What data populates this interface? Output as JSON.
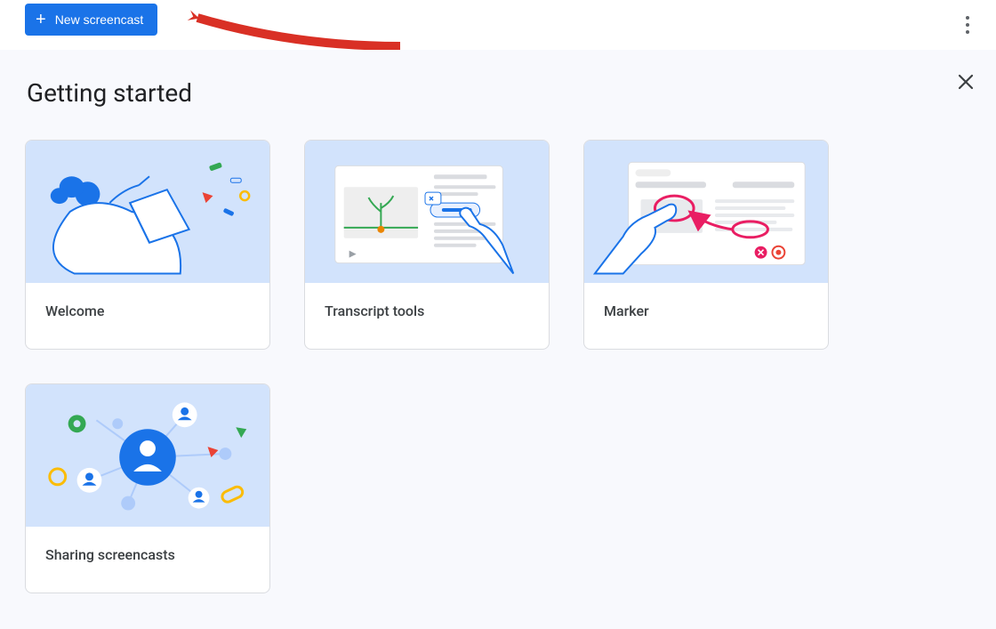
{
  "toolbar": {
    "new_button_label": "New screencast"
  },
  "panel": {
    "title": "Getting started"
  },
  "cards": [
    {
      "id": "welcome",
      "title": "Welcome"
    },
    {
      "id": "transcript",
      "title": "Transcript tools"
    },
    {
      "id": "marker",
      "title": "Marker"
    },
    {
      "id": "sharing",
      "title": "Sharing screencasts"
    }
  ],
  "colors": {
    "primary": "#1a73e8",
    "illus_bg": "#d2e3fc",
    "panel_bg": "#f8f9fd",
    "border": "#dadce0",
    "text": "#202124",
    "text2": "#3c4043",
    "icon": "#5f6368",
    "accent_green": "#34a853",
    "accent_red": "#ea4335",
    "accent_yellow": "#fbbc04",
    "accent_magenta": "#e91e63",
    "anno_red": "#d93025"
  }
}
